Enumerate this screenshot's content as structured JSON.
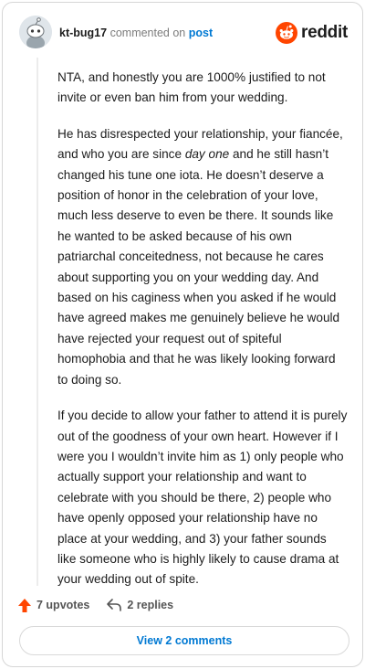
{
  "header": {
    "username": "kt-bug17",
    "commented_on": "commented on",
    "post_link": "post",
    "brand": "reddit"
  },
  "comment": {
    "p1": "NTA, and honestly you are 1000% justified to not invite or even ban him from your wedding.",
    "p2_before": "He has disrespected your relationship, your fiancée, and who you are since ",
    "p2_em": "day one",
    "p2_after": " and he still hasn’t changed his tune one iota. He doesn’t deserve a position of honor in the celebration of your love, much less deserve to even be there. It sounds like he wanted to be asked because of his own patriarchal conceitedness, not because he cares about supporting you on your wedding day. And based on his caginess when you asked if he would have agreed makes me genuinely believe he would have rejected your request out of spiteful homophobia and that he was likely looking forward to doing so.",
    "p3": "If you decide to allow your father to attend it is purely out of the goodness of your own heart. However if I were you I wouldn’t invite him as 1) only people who actually support your relationship and want to celebrate with you should be there, 2) people who have openly opposed your relationship have no place at your wedding, and 3) your father sounds like someone who is highly likely to cause drama at your wedding out of spite."
  },
  "actions": {
    "upvotes": "7 upvotes",
    "replies": "2 replies",
    "view_comments": "View 2 comments"
  },
  "icons": {
    "avatar": "snoo-avatar-icon",
    "brand": "reddit-alien-icon",
    "upvote": "upvote-arrow-icon",
    "reply": "reply-arrow-icon"
  },
  "colors": {
    "brand_orange": "#ff4500",
    "link_blue": "#0079d3",
    "upvote_orange": "#ff4500"
  }
}
